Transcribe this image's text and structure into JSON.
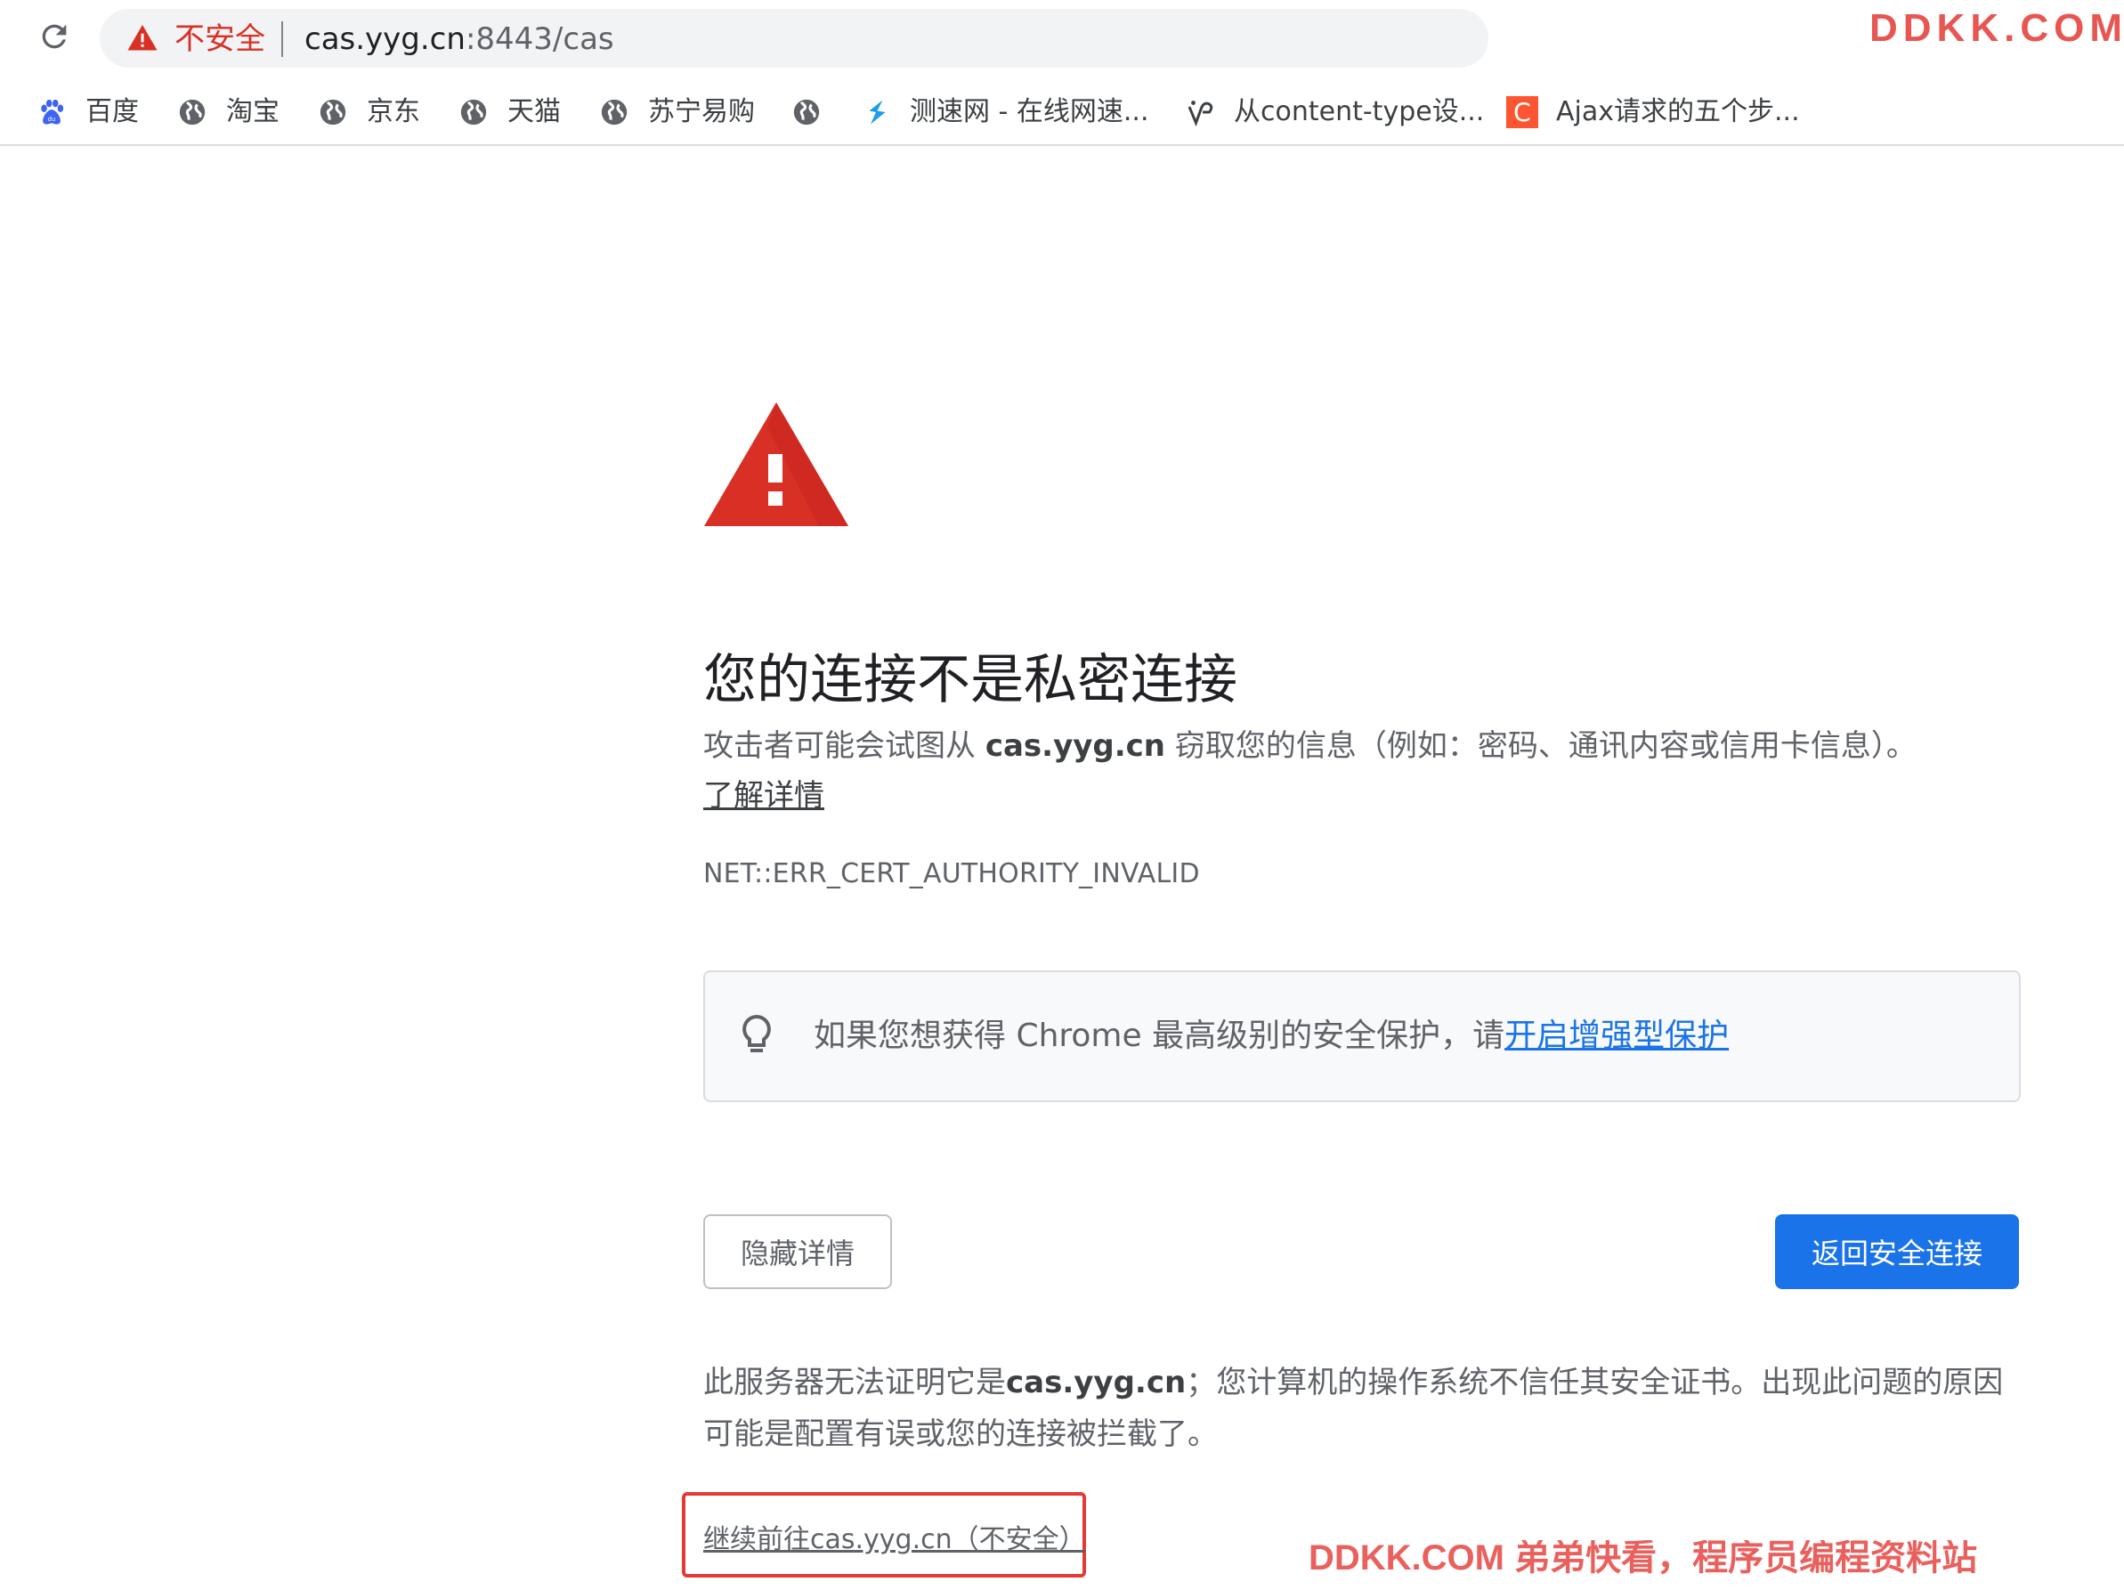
{
  "omnibox": {
    "security_status": "不安全",
    "url_host": "cas.yyg.cn",
    "url_rest": ":8443/cas"
  },
  "watermark_top": "DDKK.COM",
  "bookmarks": [
    {
      "label": "百度",
      "icon": "paw-icon"
    },
    {
      "label": "淘宝",
      "icon": "globe-icon"
    },
    {
      "label": "京东",
      "icon": "globe-icon"
    },
    {
      "label": "天猫",
      "icon": "globe-icon"
    },
    {
      "label": "苏宁易购",
      "icon": "globe-icon"
    },
    {
      "label": "",
      "icon": "globe-icon"
    },
    {
      "label": "测速网 - 在线网速...",
      "icon": "speedtest-icon"
    },
    {
      "label": "从content-type设...",
      "icon": "bookmark-favicon-icon"
    },
    {
      "label": "Ajax请求的五个步...",
      "icon": "csdn-icon"
    }
  ],
  "interstitial": {
    "heading": "您的连接不是私密连接",
    "para_prefix": "攻击者可能会试图从 ",
    "para_host": "cas.yyg.cn",
    "para_suffix": " 窃取您的信息（例如：密码、通讯内容或信用卡信息）。",
    "learn_more": "了解详情",
    "error_code": "NET::ERR_CERT_AUTHORITY_INVALID",
    "tip_prefix": "如果您想获得 Chrome 最高级别的安全保护，请",
    "tip_link": "开启增强型保护",
    "hide_details_button": "隐藏详情",
    "back_to_safety_button": "返回安全连接",
    "details_prefix": "此服务器无法证明它是",
    "details_host": "cas.yyg.cn",
    "details_suffix": "；您计算机的操作系统不信任其安全证书。出现此问题的原因可能是配置有误或您的连接被拦截了。",
    "proceed_link": "继续前往cas.yyg.cn（不安全）"
  },
  "watermark_bottom": "DDKK.COM 弟弟快看，程序员编程资料站",
  "colors": {
    "warning_red": "#d93025",
    "primary_blue": "#1a73e8",
    "annotation_red": "#e53935"
  }
}
